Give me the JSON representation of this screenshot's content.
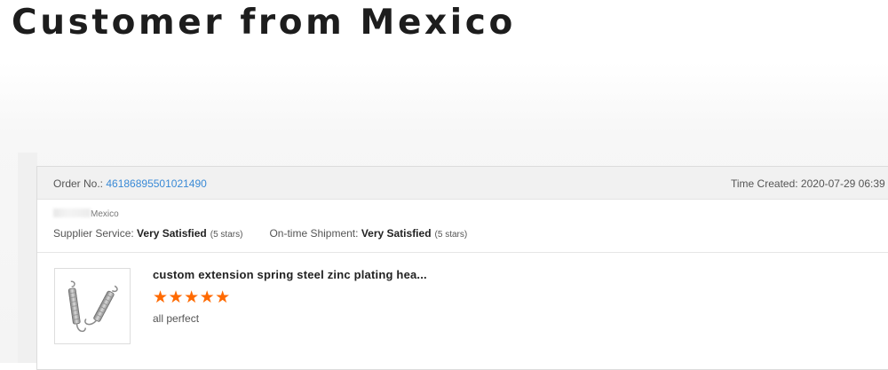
{
  "page": {
    "title": "Customer from Mexico"
  },
  "order": {
    "label": "Order No.: ",
    "number": "46186895501021490",
    "time_label": "Time Created: ",
    "time_value": "2020-07-29 06:39"
  },
  "buyer": {
    "country": "Mexico"
  },
  "ratings": {
    "supplier": {
      "label": "Supplier Service: ",
      "value": "Very Satisfied",
      "stars_text": "(5 stars)",
      "stars": 5
    },
    "shipment": {
      "label": "On-time Shipment: ",
      "value": "Very Satisfied",
      "stars_text": "(5 stars)",
      "stars": 5
    }
  },
  "product": {
    "title": "custom extension spring steel zinc plating hea...",
    "rating": 5,
    "stars_display": "★★★★★",
    "review": "all perfect",
    "image_icon": "extension-spring-icon"
  },
  "colors": {
    "accent_link": "#3a8ad6",
    "star": "#ff6a00",
    "title": "#1d1d1d"
  }
}
